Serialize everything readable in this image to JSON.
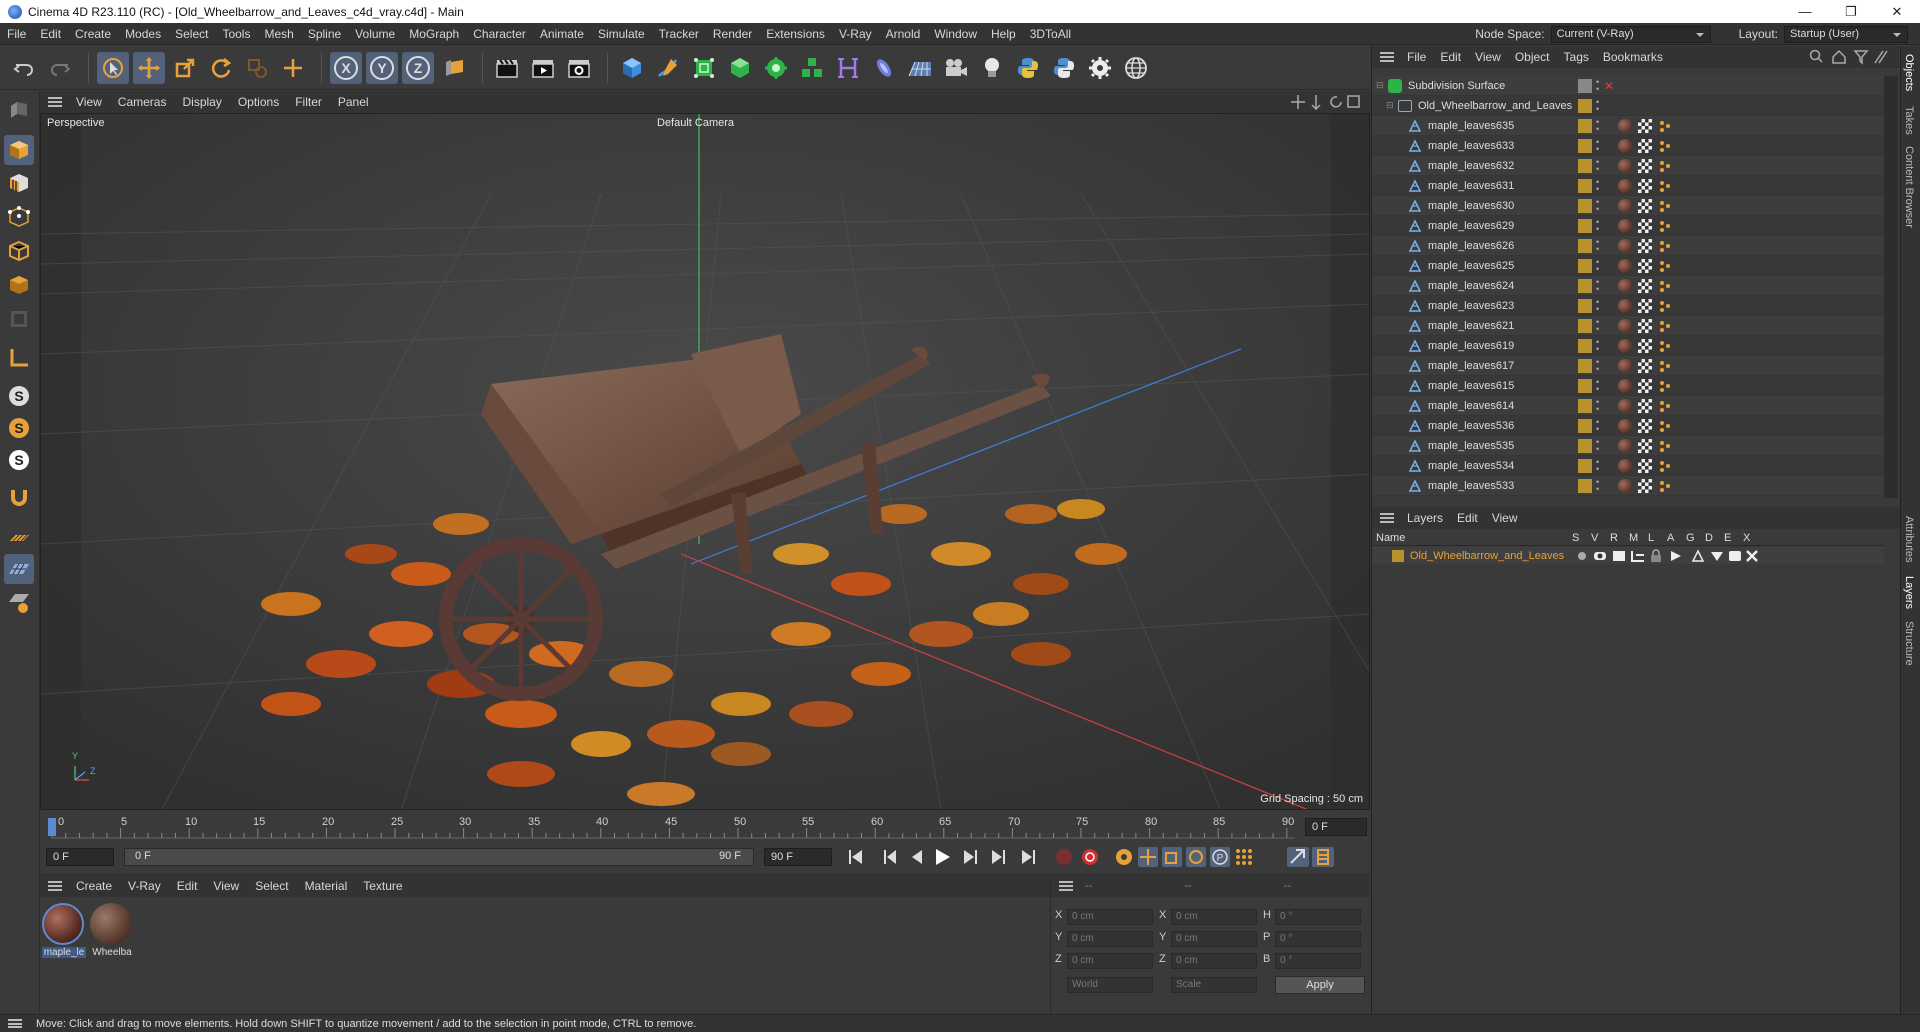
{
  "window": {
    "title": "Cinema 4D R23.110 (RC) - [Old_Wheelbarrow_and_Leaves_c4d_vray.c4d] - Main",
    "minimize": "—",
    "maximize": "❐",
    "close": "✕"
  },
  "menu": {
    "items": [
      "File",
      "Edit",
      "Create",
      "Modes",
      "Select",
      "Tools",
      "Mesh",
      "Spline",
      "Volume",
      "MoGraph",
      "Character",
      "Animate",
      "Simulate",
      "Tracker",
      "Render",
      "Extensions",
      "V-Ray",
      "Arnold",
      "Window",
      "Help",
      "3DToAll"
    ],
    "node_space_label": "Node Space:",
    "node_space_value": "Current (V-Ray)",
    "layout_label": "Layout:",
    "layout_value": "Startup (User)"
  },
  "viewport": {
    "menu": [
      "View",
      "Cameras",
      "Display",
      "Options",
      "Filter",
      "Panel"
    ],
    "view_name": "Perspective",
    "camera": "Default Camera",
    "grid_spacing": "Grid Spacing : 50 cm",
    "axis_y": "Y",
    "axis_z": "Z"
  },
  "timeline": {
    "ticks": [
      "0",
      "5",
      "10",
      "15",
      "20",
      "25",
      "30",
      "35",
      "40",
      "45",
      "50",
      "55",
      "60",
      "65",
      "70",
      "75",
      "80",
      "85",
      "90"
    ],
    "current_frame_field": "0 F"
  },
  "transport": {
    "start": "0 F",
    "range_start": "0 F",
    "range_end": "90 F",
    "end": "90 F"
  },
  "materials": {
    "menu": [
      "Create",
      "V-Ray",
      "Edit",
      "View",
      "Select",
      "Material",
      "Texture"
    ],
    "items": [
      {
        "label": "maple_le"
      },
      {
        "label": "Wheelba"
      }
    ]
  },
  "coords": {
    "header1": "--",
    "header2": "--",
    "header3": "--",
    "rows": [
      {
        "a": "X",
        "av": "0 cm",
        "b": "X",
        "bv": "0 cm",
        "c": "H",
        "cv": "0 °"
      },
      {
        "a": "Y",
        "av": "0 cm",
        "b": "Y",
        "bv": "0 cm",
        "c": "P",
        "cv": "0 °"
      },
      {
        "a": "Z",
        "av": "0 cm",
        "b": "Z",
        "bv": "0 cm",
        "c": "B",
        "cv": "0 °"
      }
    ],
    "world": "World",
    "scale": "Scale",
    "apply": "Apply"
  },
  "objects": {
    "menu": [
      "File",
      "Edit",
      "View",
      "Object",
      "Tags",
      "Bookmarks"
    ],
    "root": "Subdivision Surface",
    "group": "Old_Wheelbarrow_and_Leaves",
    "items": [
      "maple_leaves635",
      "maple_leaves633",
      "maple_leaves632",
      "maple_leaves631",
      "maple_leaves630",
      "maple_leaves629",
      "maple_leaves626",
      "maple_leaves625",
      "maple_leaves624",
      "maple_leaves623",
      "maple_leaves621",
      "maple_leaves619",
      "maple_leaves617",
      "maple_leaves615",
      "maple_leaves614",
      "maple_leaves536",
      "maple_leaves535",
      "maple_leaves534",
      "maple_leaves533"
    ]
  },
  "layers": {
    "menu": [
      "Layers",
      "Edit",
      "View"
    ],
    "columns": [
      "Name",
      "S",
      "V",
      "R",
      "M",
      "L",
      "A",
      "G",
      "D",
      "E",
      "X"
    ],
    "row": "Old_Wheelbarrow_and_Leaves"
  },
  "side_tabs": [
    "Objects",
    "Takes",
    "Content Browser",
    "Attributes",
    "Layers",
    "Structure"
  ],
  "status": "Move: Click and drag to move elements. Hold down SHIFT to quantize movement / add to the selection in point mode, CTRL to remove.",
  "colors": {
    "accent": "#e8a13a",
    "selection": "#52627a",
    "layer": "#b8922c"
  }
}
